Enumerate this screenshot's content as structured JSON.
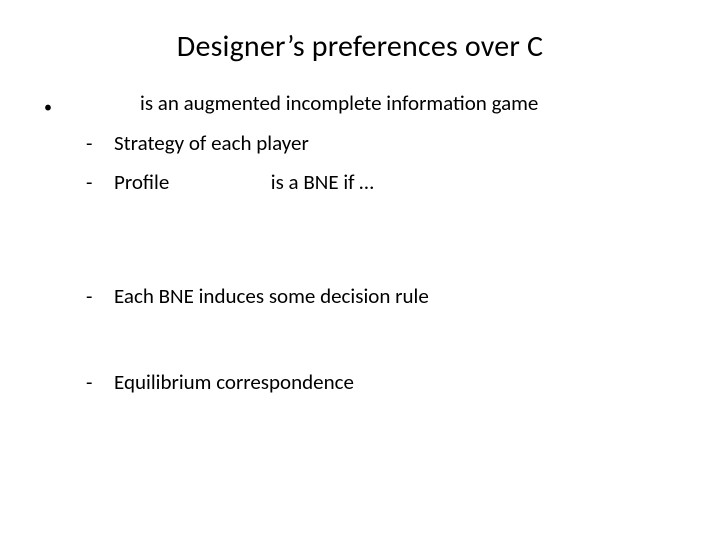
{
  "title": "Designer’s preferences over C",
  "lvl1_text": "is an augmented incomplete information game",
  "sub": {
    "s1": "Strategy of each player",
    "s2_profile": "Profile",
    "s2_rest": "is a BNE  if …",
    "s3": "Each BNE induces some decision rule",
    "s4": "Equilibrium correspondence"
  }
}
